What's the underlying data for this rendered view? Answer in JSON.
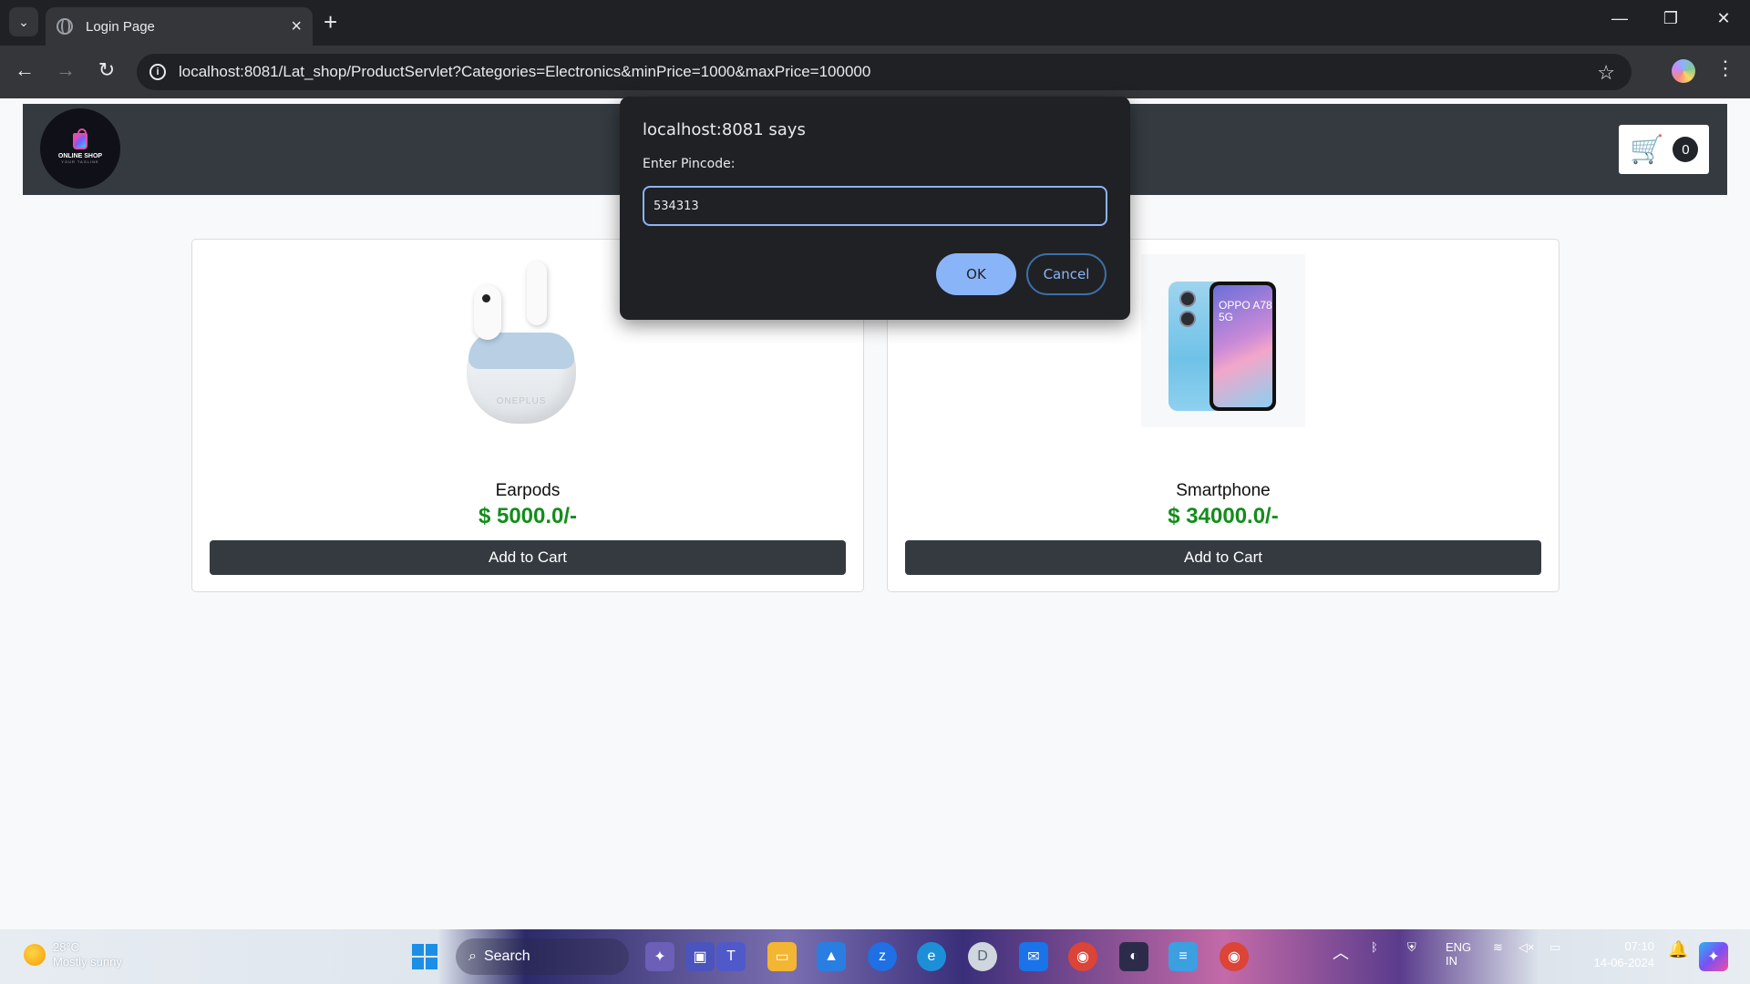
{
  "browser": {
    "tab_title": "Login Page",
    "url": "localhost:8081/Lat_shop/ProductServlet?Categories=Electronics&minPrice=1000&maxPrice=100000"
  },
  "site": {
    "logo_text": "ONLINE SHOP",
    "logo_subtext": "YOUR TAGLINE",
    "cart_count": "0"
  },
  "products": [
    {
      "name": "Earpods",
      "price": "$ 5000.0/-",
      "button": "Add to Cart",
      "image_brand": "ONEPLUS"
    },
    {
      "name": "Smartphone",
      "price": "$ 34000.0/-",
      "button": "Add to Cart",
      "image_brand": "OPPO A78 5G"
    }
  ],
  "dialog": {
    "title": "localhost:8081 says",
    "label": "Enter Pincode:",
    "input_value": "534313",
    "ok_label": "OK",
    "cancel_label": "Cancel"
  },
  "taskbar": {
    "weather_temp": "28°C",
    "weather_desc": "Mostly sunny",
    "search_label": "Search",
    "lang": "ENG",
    "region": "IN",
    "time": "07:10",
    "date": "14-06-2024"
  },
  "colors": {
    "header_bg": "#343a40",
    "price_green": "#138d1b",
    "dialog_accent": "#8ab4f8"
  }
}
